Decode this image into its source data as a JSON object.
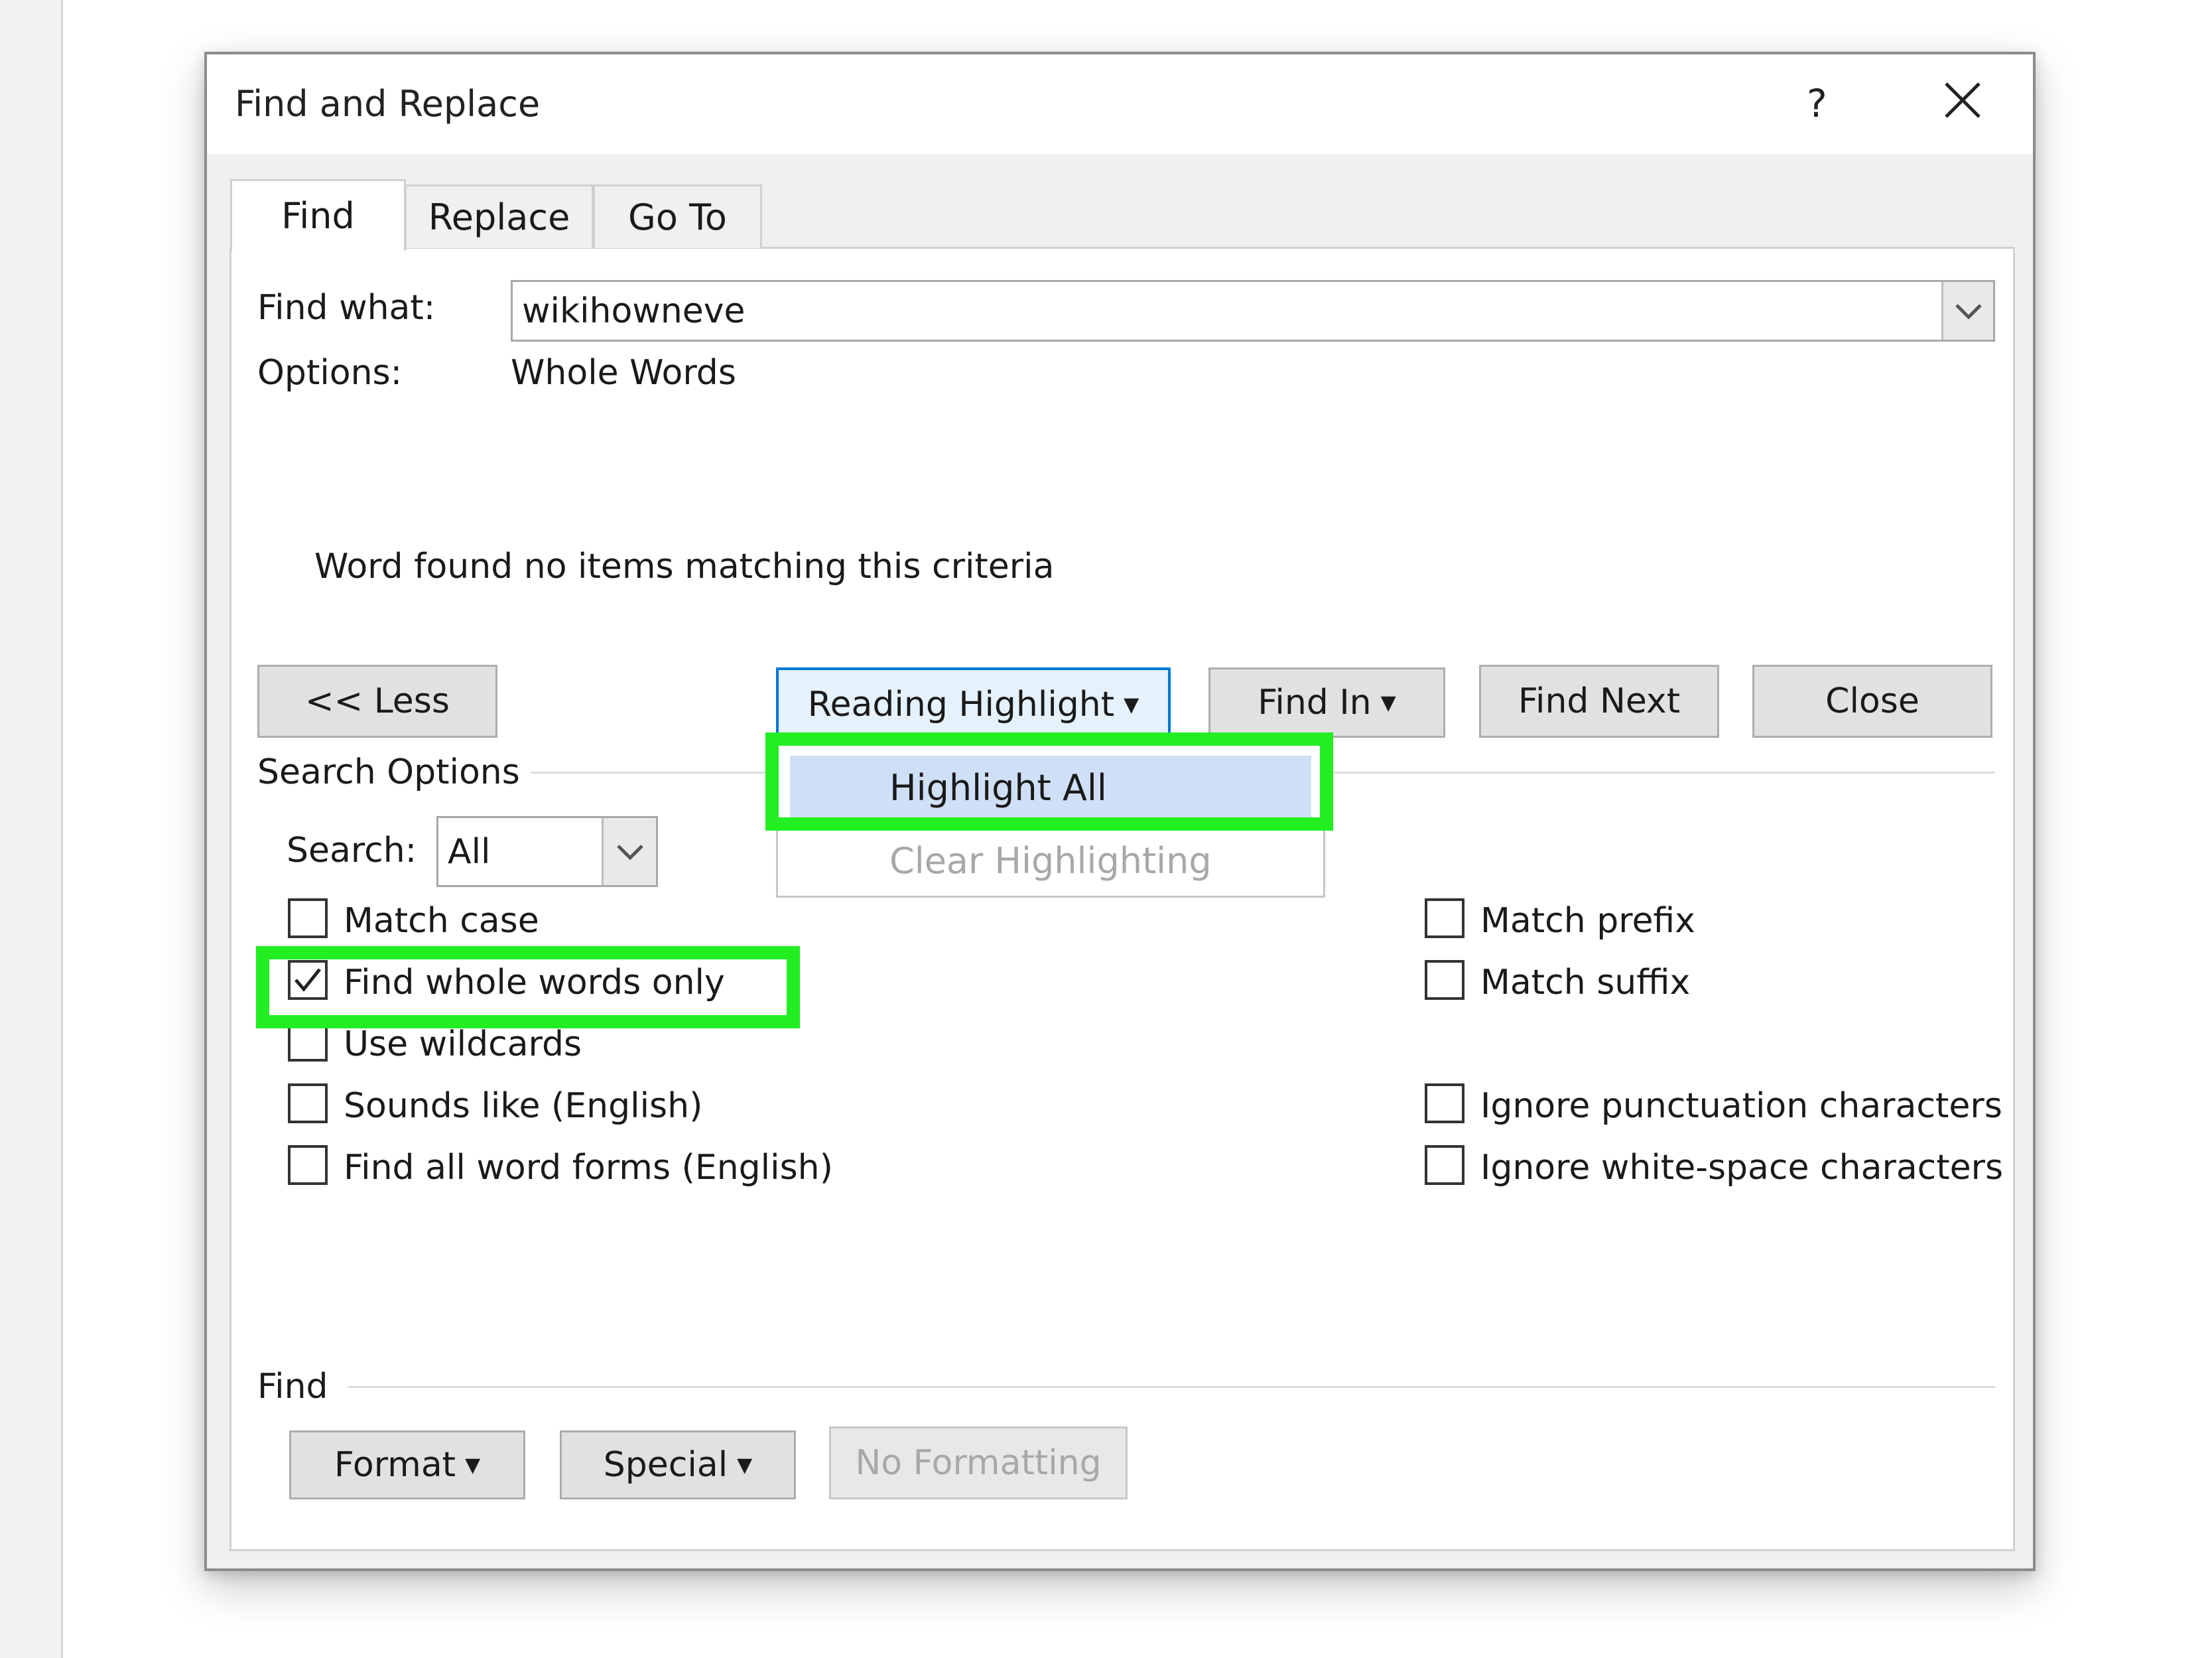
{
  "dialog": {
    "title": "Find and Replace",
    "help_glyph": "?",
    "close_glyph": "✕"
  },
  "tabs": [
    {
      "label": "Find",
      "active": true
    },
    {
      "label": "Replace",
      "active": false
    },
    {
      "label": "Go To",
      "active": false
    }
  ],
  "find": {
    "label": "Find what:",
    "value": "wikihowneve",
    "options_label": "Options:",
    "options_value": "Whole Words",
    "status_message": "Word found no items matching this criteria"
  },
  "buttons": {
    "less": "<< Less",
    "reading_highlight": "Reading Highlight",
    "find_in": "Find In",
    "find_next": "Find Next",
    "close": "Close"
  },
  "highlight_menu": {
    "items": [
      {
        "label": "Highlight All",
        "enabled": true,
        "hovered": true
      },
      {
        "label": "Clear Highlighting",
        "enabled": false
      }
    ]
  },
  "search_options": {
    "heading": "Search Options",
    "search_label": "Search:",
    "search_value": "All",
    "left_checks": [
      {
        "label": "Match case",
        "checked": false
      },
      {
        "label": "Find whole words only",
        "checked": true
      },
      {
        "label": "Use wildcards",
        "checked": false
      },
      {
        "label": "Sounds like (English)",
        "checked": false
      },
      {
        "label": "Find all word forms (English)",
        "checked": false
      }
    ],
    "right_checks": [
      {
        "label": "Match prefix",
        "checked": false
      },
      {
        "label": "Match suffix",
        "checked": false
      },
      {
        "label": "Ignore punctuation characters",
        "checked": false
      },
      {
        "label": "Ignore white-space characters",
        "checked": false
      }
    ]
  },
  "find_section": {
    "heading": "Find",
    "format": "Format",
    "special": "Special",
    "no_formatting": "No Formatting"
  },
  "annotations": {
    "highlight_color": "#22ee22"
  },
  "colors": {
    "focus_border": "#0078d7",
    "menu_hover": "#cfe0f6"
  }
}
